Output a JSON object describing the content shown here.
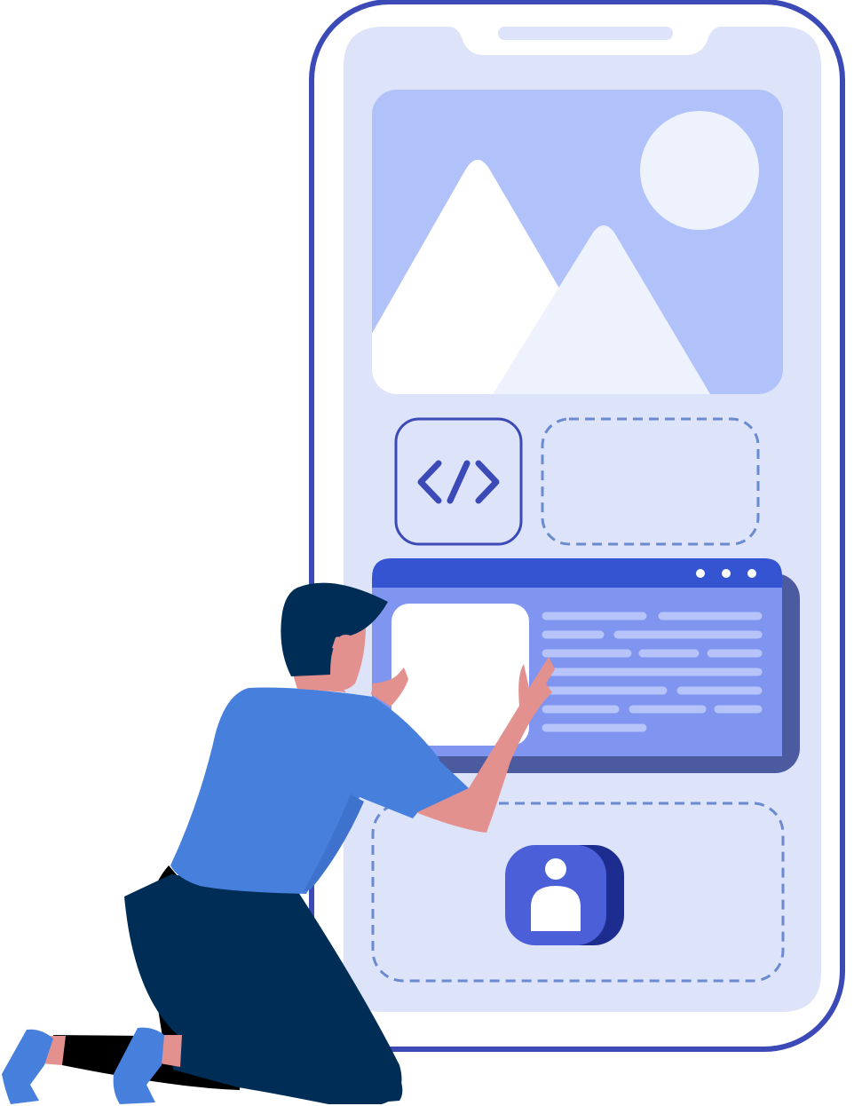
{
  "illustration": {
    "subject": "",
    "phone": {
      "hero_image_icon": "image-placeholder-icon",
      "code_block_icon": "code-icon",
      "window_dots": 3,
      "text_line_rows": 7,
      "profile_icon": "user-icon"
    },
    "colors": {
      "phone_frame": "#3c4ab8",
      "phone_screen": "#dde3f9",
      "hero_bg": "#b1c2fa",
      "hero_light": "#eef2fd",
      "window_header": "#3454d1",
      "window_body": "#7f95f0",
      "window_shadow": "#4c5ba0",
      "text_lines": "#b6c4fa",
      "dashed": "#6b8bd0",
      "profile_front": "#4a5fd8",
      "profile_back": "#1c2d8f",
      "shirt": "#477fdc",
      "pants": "#002d56",
      "hair": "#002d56",
      "skin": "#e2918f",
      "shoes": "#477fdc"
    }
  }
}
